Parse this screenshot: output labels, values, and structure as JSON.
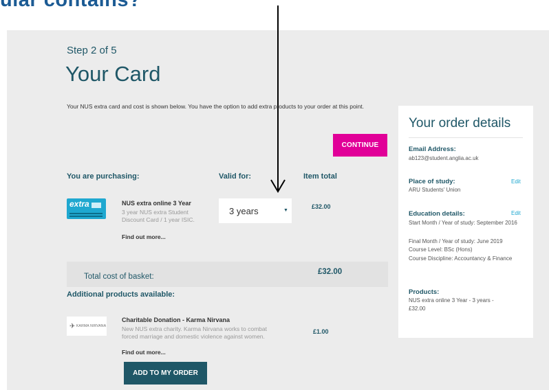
{
  "overlay": {
    "top_heading": "ular contains?"
  },
  "header": {
    "step": "Step 2 of 5",
    "title": "Your Card"
  },
  "intro": "Your NUS extra card and cost is shown below. You have the option to add extra products to your order at this point.",
  "buttons": {
    "continue": "CONTINUE",
    "add_to_order": "ADD TO MY ORDER"
  },
  "columns": {
    "purchasing": "You are purchasing:",
    "valid_for": "Valid for:",
    "item_total": "Item total"
  },
  "product": {
    "thumb_text": "extra",
    "name": "NUS extra online 3 Year",
    "desc": "3 year NUS extra Student Discount Card / 1 year ISIC.",
    "find_more": "Find out more...",
    "valid_selected": "3 years",
    "price": "£32.00"
  },
  "total": {
    "label": "Total cost of basket:",
    "value": "£32.00"
  },
  "additional": {
    "heading": "Additional products available:",
    "thumb_text": "KARMA NIRVANA",
    "name": "Charitable Donation - Karma Nirvana",
    "desc": "New NUS extra charity. Karma Nirvana works to combat forced marriage and domestic violence against women.",
    "find_more": "Find out more...",
    "price": "£1.00"
  },
  "order_details": {
    "title": "Your order details",
    "email_label": "Email Address:",
    "email": "ab123@student.anglia.ac.uk",
    "place_label": "Place of study:",
    "place": "ARU Students' Union",
    "edit": "Edit",
    "edu_label": "Education details:",
    "edu_lines": [
      "Start Month / Year of study: September 2016",
      "Final Month / Year of study: June 2019",
      "Course Level: BSc (Hons)",
      "Course Discipline: Accountancy & Finance"
    ],
    "products_label": "Products:",
    "products": "NUS extra online 3 Year - 3 years - £32.00"
  },
  "colors": {
    "teal": "#1f5767",
    "magenta": "#e10098",
    "panel": "#ececec",
    "link_blue": "#1fa8d0"
  }
}
